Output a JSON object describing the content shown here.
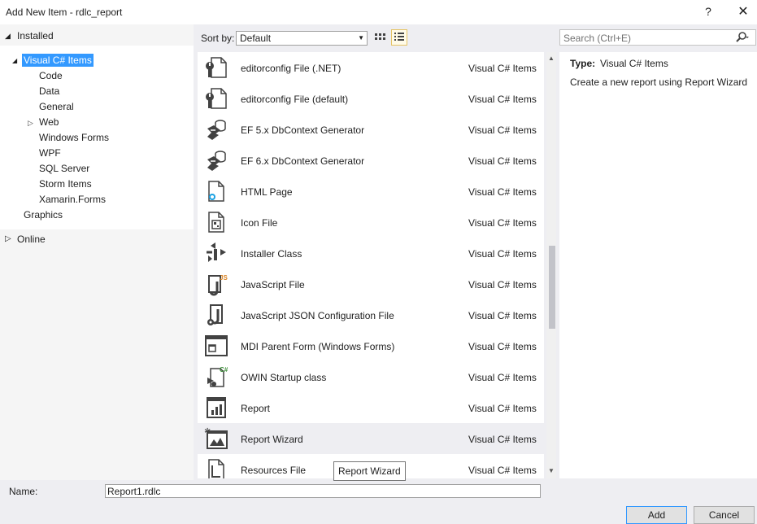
{
  "window": {
    "title": "Add New Item - rdlc_report",
    "help_label": "?",
    "close_label": "✕"
  },
  "tree": {
    "installed": "Installed",
    "visual_csharp": "Visual C# Items",
    "children": [
      "Code",
      "Data",
      "General",
      "Web",
      "Windows Forms",
      "WPF",
      "SQL Server",
      "Storm Items",
      "Xamarin.Forms"
    ],
    "graphics": "Graphics",
    "online": "Online"
  },
  "sort": {
    "label": "Sort by:",
    "value": "Default"
  },
  "search": {
    "placeholder": "Search (Ctrl+E)"
  },
  "items": [
    {
      "name": "editorconfig File (.NET)",
      "category": "Visual C# Items",
      "icon": "wrench-file-icon"
    },
    {
      "name": "editorconfig File (default)",
      "category": "Visual C# Items",
      "icon": "wrench-file-icon"
    },
    {
      "name": "EF 5.x DbContext Generator",
      "category": "Visual C# Items",
      "icon": "database-generator-icon"
    },
    {
      "name": "EF 6.x DbContext Generator",
      "category": "Visual C# Items",
      "icon": "database-generator-icon"
    },
    {
      "name": "HTML Page",
      "category": "Visual C# Items",
      "icon": "html-page-icon"
    },
    {
      "name": "Icon File",
      "category": "Visual C# Items",
      "icon": "icon-file-icon"
    },
    {
      "name": "Installer Class",
      "category": "Visual C# Items",
      "icon": "installer-class-icon"
    },
    {
      "name": "JavaScript File",
      "category": "Visual C# Items",
      "icon": "javascript-file-icon"
    },
    {
      "name": "JavaScript JSON Configuration File",
      "category": "Visual C# Items",
      "icon": "json-config-icon"
    },
    {
      "name": "MDI Parent Form (Windows Forms)",
      "category": "Visual C# Items",
      "icon": "mdi-form-icon"
    },
    {
      "name": "OWIN Startup class",
      "category": "Visual C# Items",
      "icon": "owin-startup-icon"
    },
    {
      "name": "Report",
      "category": "Visual C# Items",
      "icon": "report-icon"
    },
    {
      "name": "Report Wizard",
      "category": "Visual C# Items",
      "icon": "report-wizard-icon",
      "selected": true
    },
    {
      "name": "Resources File",
      "category": "Visual C# Items",
      "icon": "resources-file-icon"
    }
  ],
  "detail": {
    "type_label": "Type:",
    "type_value": "Visual C# Items",
    "description": "Create a new report using Report Wizard"
  },
  "tooltip": "Report Wizard",
  "name_field": {
    "label": "Name:",
    "value": "Report1.rdlc"
  },
  "buttons": {
    "add": "Add",
    "cancel": "Cancel"
  },
  "colors": {
    "selection": "#3399ff",
    "dialog_bg": "#eeeef2"
  }
}
